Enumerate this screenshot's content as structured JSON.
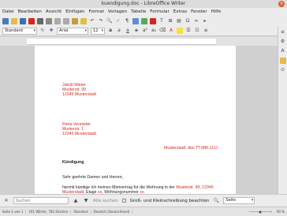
{
  "window": {
    "title": "kuendigung.doc - LibreOffice Writer",
    "close": "×"
  },
  "menu": [
    "Datei",
    "Bearbeiten",
    "Ansicht",
    "Einfügen",
    "Format",
    "Vorlagen",
    "Tabelle",
    "Formular",
    "Extras",
    "Fenster",
    "Hilfe"
  ],
  "toolbar": {
    "style": "Standard",
    "font": "Arial",
    "size": "12"
  },
  "doc": {
    "sender": [
      "Jakob Mieter",
      "Musterstr. 99",
      "12345 Musterstadt"
    ],
    "recipient": [
      "Petra Vermieter",
      "Musterstr. 1",
      "12345 Musterstadt"
    ],
    "date_place": "Musterstadt, den",
    "date_value": "TT.MM.JJJJ",
    "subject": "Kündigung",
    "salutation": "Sehr geehrte Damen und Herren,",
    "body_1": "hiermit kündige ich meinen Mietvertrag für die Wohnung in der",
    "body_addr": "Musterstr. 99, 12345",
    "body_city": "Musterstadt,",
    "body_2": "Etage",
    "body_xx1": "xx",
    "body_3": ", Wohnungsnummer",
    "body_xx2": "xx."
  },
  "find": {
    "placeholder": "Suchen",
    "all_label": "Alle suchen",
    "case_label": "Groß- und Kleinschreibung beachten",
    "page_label": "Seite"
  },
  "status": {
    "page": "Seite 1 von 1",
    "words": "161 Wörter, 783 Zeichen",
    "style": "Standard",
    "lang": "Deutsch (Deutschland)",
    "zoom": "90 %"
  },
  "colors": {
    "accent_red": "#d9261c"
  }
}
